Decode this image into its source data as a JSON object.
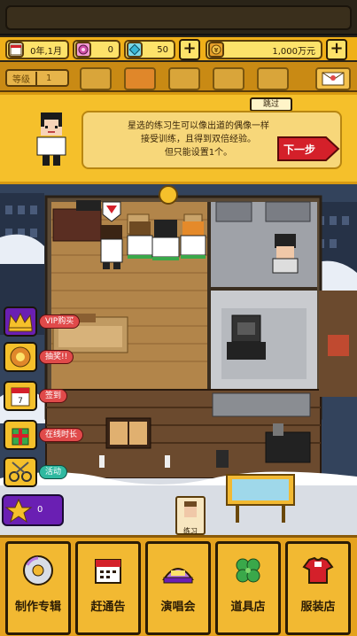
{
  "resources": {
    "date": "0年,1月",
    "gems": "0",
    "diamonds": "50",
    "money": "1,000万元",
    "add_label": "+"
  },
  "level": {
    "label": "等级",
    "value": "1"
  },
  "tutorial": {
    "skip_label": "跳过",
    "message_line1": "星选的练习生可以像出道的偶像一样",
    "message_line2": "接受训练，且得到双倍经验。",
    "message_line3": "但只能设置1个。",
    "next_label": "下一步"
  },
  "side_menu": [
    {
      "label": "VIP购买",
      "icon": "crown-icon"
    },
    {
      "label": "抽奖!!",
      "icon": "lottery-icon"
    },
    {
      "label": "签到",
      "icon": "calendar-icon"
    },
    {
      "label": "在线时长",
      "icon": "gift-icon"
    },
    {
      "label": "活动",
      "icon": "scissors-icon"
    }
  ],
  "star_count": "0",
  "sign_label": "练习",
  "bottom_nav": [
    {
      "label": "制作专辑",
      "icon": "cd-icon"
    },
    {
      "label": "赶通告",
      "icon": "schedule-icon"
    },
    {
      "label": "演唱会",
      "icon": "concert-icon"
    },
    {
      "label": "道具店",
      "icon": "clover-icon"
    },
    {
      "label": "服装店",
      "icon": "shirt-icon"
    }
  ],
  "colors": {
    "accent_yellow": "#f5c02b",
    "next_red": "#d4202a",
    "vip_purple": "#6a1fb3"
  }
}
